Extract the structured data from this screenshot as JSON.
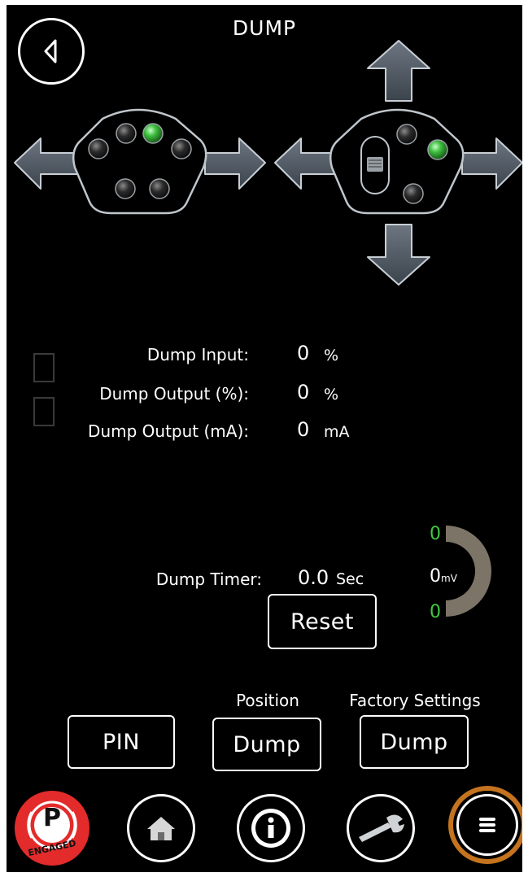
{
  "header": {
    "title": "DUMP"
  },
  "controls": [
    {
      "label": "Dump Input:",
      "value": "0",
      "unit": "%"
    },
    {
      "label": "Dump Output (%):",
      "value": "0",
      "unit": "%"
    },
    {
      "label": "Dump Output (mA):",
      "value": "0",
      "unit": "mA"
    }
  ],
  "timer": {
    "label": "Dump Timer:",
    "value": "0.0",
    "unit": "Sec",
    "reset_label": "Reset"
  },
  "gauge": {
    "top_value": "0",
    "center_value": "0",
    "center_unit": "mV",
    "bottom_value": "0"
  },
  "buttons": {
    "pin_label": "PIN",
    "position_caption": "Position",
    "position_label": "Dump",
    "factory_caption": "Factory Settings",
    "factory_label": "Dump"
  },
  "nav": {
    "parking_letter": "P",
    "parking_status": "ENGAGED"
  },
  "colors": {
    "indicator_active": "#3fbf3f",
    "value_green": "#3fc83f",
    "accent_orange": "#c4731e",
    "parking_red": "#e32b2b"
  },
  "icons": [
    "back-icon",
    "arrow-left-icon",
    "arrow-right-icon",
    "arrow-up-icon",
    "arrow-down-icon",
    "home-icon",
    "info-icon",
    "wrench-icon",
    "menu-icon",
    "parking-brake-icon"
  ]
}
